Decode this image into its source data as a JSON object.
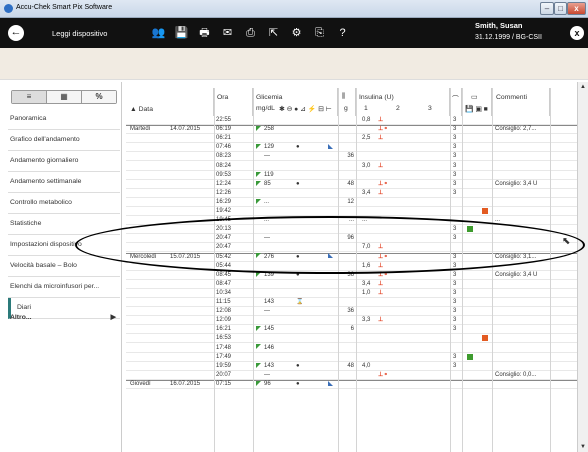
{
  "window": {
    "title": "Accu-Chek Smart Pix Software",
    "min_label": "–",
    "max_label": "□",
    "close_label": "x"
  },
  "toolbar": {
    "back_icon": "←",
    "read_device_label": "Leggi dispositivo",
    "icons": [
      {
        "name": "users-icon",
        "glyph": "👥"
      },
      {
        "name": "save-icon",
        "glyph": "💾"
      },
      {
        "name": "print-icon",
        "glyph": "🖶"
      },
      {
        "name": "email-icon",
        "glyph": "✉"
      },
      {
        "name": "pdf-icon",
        "glyph": "⎙"
      },
      {
        "name": "export-icon",
        "glyph": "⇱"
      },
      {
        "name": "settings-icon",
        "glyph": "⚙"
      },
      {
        "name": "device-icon",
        "glyph": "⎘"
      },
      {
        "name": "help-icon",
        "glyph": "?"
      }
    ]
  },
  "patient": {
    "name": "Smith, Susan",
    "info": "31.12.1999 / BG-CSII",
    "close_label": "x"
  },
  "view_toggle": [
    "≡",
    "▦",
    "%"
  ],
  "nav": {
    "items": [
      {
        "label": "Panoramica",
        "active": false
      },
      {
        "label": "Grafico dell'andamento",
        "active": false
      },
      {
        "label": "Andamento giornaliero",
        "active": false
      },
      {
        "label": "Andamento settimanale",
        "active": false
      },
      {
        "label": "Controllo metabolico",
        "active": false
      },
      {
        "label": "Statistiche",
        "active": false
      },
      {
        "label": "Impostazioni dispositivo",
        "active": false
      },
      {
        "label": "Velocità basale – Bolo",
        "active": false
      },
      {
        "label": "Elenchi da microinfusori per...",
        "active": false
      },
      {
        "label": "Diari",
        "active": true
      }
    ],
    "more_label": "Altro..."
  },
  "table": {
    "headers": {
      "data": "▲ Data",
      "ora": "Ora",
      "glicemia": "Glicemia",
      "glicemia_unit": "mg/dL",
      "glicemia_icons": "✱ ⊖ ● ⊿ ⚡ ⊟ ⊢",
      "carbo": "⫼",
      "carbo_unit": "g",
      "insulina": "Insulina (U)",
      "insulina_cols": [
        "1",
        "2",
        "3"
      ],
      "basal_icon": "⌒",
      "pump_icon": "▭",
      "pump_sub_icons": "💾 ▣ ■",
      "commenti": "Commenti"
    },
    "rows": [
      {
        "day": "",
        "date": "",
        "time": "22:55",
        "flag": "",
        "bg": "",
        "evt": "",
        "mark": "",
        "carb": "",
        "ins": "0,8",
        "insmark": "⊥",
        "basal": "3",
        "pump": "",
        "comment": ""
      },
      {
        "day": "Martedì",
        "date": "14.07.2015",
        "time": "06:19",
        "flag": "green",
        "bg": "258",
        "evt": "",
        "mark": "",
        "carb": "",
        "ins": "",
        "insmark": "⊥⚬",
        "basal": "3",
        "pump": "",
        "comment": "Consiglio: 2,7..."
      },
      {
        "day": "",
        "date": "",
        "time": "06:21",
        "flag": "",
        "bg": "",
        "evt": "",
        "mark": "",
        "carb": "",
        "ins": "2,5",
        "insmark": "⊥",
        "basal": "3",
        "pump": "",
        "comment": ""
      },
      {
        "day": "",
        "date": "",
        "time": "07:46",
        "flag": "green",
        "bg": "129",
        "evt": "●",
        "mark": "blue",
        "carb": "",
        "ins": "",
        "insmark": "",
        "basal": "3",
        "pump": "",
        "comment": ""
      },
      {
        "day": "",
        "date": "",
        "time": "08:23",
        "flag": "",
        "bg": "—",
        "evt": "",
        "mark": "",
        "carb": "36",
        "ins": "",
        "insmark": "",
        "basal": "3",
        "pump": "",
        "comment": ""
      },
      {
        "day": "",
        "date": "",
        "time": "08:24",
        "flag": "",
        "bg": "",
        "evt": "",
        "mark": "",
        "carb": "",
        "ins": "3,0",
        "insmark": "⊥",
        "basal": "3",
        "pump": "",
        "comment": ""
      },
      {
        "day": "",
        "date": "",
        "time": "09:53",
        "flag": "green",
        "bg": "119",
        "evt": "",
        "mark": "",
        "carb": "",
        "ins": "",
        "insmark": "",
        "basal": "3",
        "pump": "",
        "comment": ""
      },
      {
        "day": "",
        "date": "",
        "time": "12:24",
        "flag": "green",
        "bg": "85",
        "evt": "●",
        "mark": "",
        "carb": "48",
        "ins": "",
        "insmark": "⊥⚬",
        "basal": "3",
        "pump": "",
        "comment": "Consiglio: 3,4 U"
      },
      {
        "day": "",
        "date": "",
        "time": "12:26",
        "flag": "",
        "bg": "",
        "evt": "",
        "mark": "",
        "carb": "",
        "ins": "3,4",
        "insmark": "⊥",
        "basal": "3",
        "pump": "",
        "comment": ""
      },
      {
        "day": "",
        "date": "",
        "time": "16:29",
        "flag": "green",
        "bg": "...",
        "evt": "",
        "mark": "",
        "carb": "12",
        "ins": "",
        "insmark": "",
        "basal": "",
        "pump": "",
        "comment": ""
      },
      {
        "day": "",
        "date": "",
        "time": "19:42",
        "flag": "",
        "bg": "",
        "evt": "",
        "mark": "",
        "carb": "",
        "ins": "",
        "insmark": "",
        "basal": "",
        "pump": "orange",
        "comment": ""
      },
      {
        "day": "",
        "date": "",
        "time": "19:45",
        "flag": "",
        "bg": "...",
        "evt": "",
        "mark": "",
        "carb": "...",
        "ins": "...",
        "insmark": "",
        "basal": "",
        "pump": "",
        "comment": "..."
      },
      {
        "day": "",
        "date": "",
        "time": "20:13",
        "flag": "",
        "bg": "",
        "evt": "",
        "mark": "",
        "carb": "",
        "ins": "",
        "insmark": "",
        "basal": "3",
        "pump": "green",
        "comment": ""
      },
      {
        "day": "",
        "date": "",
        "time": "20:47",
        "flag": "",
        "bg": "—",
        "evt": "",
        "mark": "",
        "carb": "96",
        "ins": "",
        "insmark": "",
        "basal": "3",
        "pump": "",
        "comment": ""
      },
      {
        "day": "",
        "date": "",
        "time": "20:47",
        "flag": "",
        "bg": "",
        "evt": "",
        "mark": "",
        "carb": "",
        "ins": "7,0",
        "insmark": "⊥",
        "basal": "",
        "pump": "",
        "comment": ""
      },
      {
        "day": "Mercoledì",
        "date": "15.07.2015",
        "time": "05:42",
        "flag": "green",
        "bg": "276",
        "evt": "●",
        "mark": "blue",
        "carb": "",
        "ins": "",
        "insmark": "⊥⚬",
        "basal": "3",
        "pump": "",
        "comment": "Consiglio: 3,1..."
      },
      {
        "day": "",
        "date": "",
        "time": "05:44",
        "flag": "",
        "bg": "",
        "evt": "",
        "mark": "",
        "carb": "",
        "ins": "1,6",
        "insmark": "⊥",
        "basal": "3",
        "pump": "",
        "comment": ""
      },
      {
        "day": "",
        "date": "",
        "time": "08:45",
        "flag": "green",
        "bg": "139",
        "evt": "●",
        "mark": "",
        "carb": "36",
        "ins": "",
        "insmark": "⊥⚬",
        "basal": "3",
        "pump": "",
        "comment": "Consiglio: 3,4 U"
      },
      {
        "day": "",
        "date": "",
        "time": "08:47",
        "flag": "",
        "bg": "",
        "evt": "",
        "mark": "",
        "carb": "",
        "ins": "3,4",
        "insmark": "⊥",
        "basal": "3",
        "pump": "",
        "comment": ""
      },
      {
        "day": "",
        "date": "",
        "time": "10:34",
        "flag": "",
        "bg": "",
        "evt": "",
        "mark": "",
        "carb": "",
        "ins": "1,0",
        "insmark": "⊥",
        "basal": "3",
        "pump": "",
        "comment": ""
      },
      {
        "day": "",
        "date": "",
        "time": "11:15",
        "flag": "",
        "bg": "143",
        "evt": "⌛",
        "mark": "",
        "carb": "",
        "ins": "",
        "insmark": "",
        "basal": "3",
        "pump": "",
        "comment": ""
      },
      {
        "day": "",
        "date": "",
        "time": "12:08",
        "flag": "",
        "bg": "—",
        "evt": "",
        "mark": "",
        "carb": "36",
        "ins": "",
        "insmark": "",
        "basal": "3",
        "pump": "",
        "comment": ""
      },
      {
        "day": "",
        "date": "",
        "time": "12:09",
        "flag": "",
        "bg": "",
        "evt": "",
        "mark": "",
        "carb": "",
        "ins": "3,3",
        "insmark": "⊥",
        "basal": "3",
        "pump": "",
        "comment": ""
      },
      {
        "day": "",
        "date": "",
        "time": "16:21",
        "flag": "green",
        "bg": "145",
        "evt": "",
        "mark": "",
        "carb": "6",
        "ins": "",
        "insmark": "",
        "basal": "3",
        "pump": "",
        "comment": ""
      },
      {
        "day": "",
        "date": "",
        "time": "16:53",
        "flag": "",
        "bg": "",
        "evt": "",
        "mark": "",
        "carb": "",
        "ins": "",
        "insmark": "",
        "basal": "",
        "pump": "orange",
        "comment": ""
      },
      {
        "day": "",
        "date": "",
        "time": "17:48",
        "flag": "green",
        "bg": "146",
        "evt": "",
        "mark": "",
        "carb": "",
        "ins": "",
        "insmark": "",
        "basal": "",
        "pump": "",
        "comment": ""
      },
      {
        "day": "",
        "date": "",
        "time": "17:49",
        "flag": "",
        "bg": "",
        "evt": "",
        "mark": "",
        "carb": "",
        "ins": "",
        "insmark": "",
        "basal": "3",
        "pump": "green",
        "comment": ""
      },
      {
        "day": "",
        "date": "",
        "time": "19:59",
        "flag": "green",
        "bg": "143",
        "evt": "●",
        "mark": "",
        "carb": "48",
        "ins": "4,0",
        "insmark": "",
        "basal": "3",
        "pump": "",
        "comment": ""
      },
      {
        "day": "",
        "date": "",
        "time": "20:07",
        "flag": "",
        "bg": "—",
        "evt": "",
        "mark": "",
        "carb": "",
        "ins": "",
        "insmark": "⊥⚬",
        "basal": "",
        "pump": "",
        "comment": "Consiglio: 0,0..."
      },
      {
        "day": "Giovedì",
        "date": "16.07.2015",
        "time": "07:15",
        "flag": "green",
        "bg": "96",
        "evt": "●",
        "mark": "blue",
        "carb": "",
        "ins": "",
        "insmark": "",
        "basal": "",
        "pump": "",
        "comment": ""
      }
    ]
  },
  "colors": {
    "toolbar_bg": "#111111",
    "banner_bg": "#f1ebe2",
    "insulin_mark": "#e23b1b",
    "flag_green": "#3a9a3a",
    "flag_blue": "#3b6fb8",
    "pump_orange": "#e35b22",
    "pump_green": "#3e9b2e"
  },
  "scroll": {
    "up_icon": "▲",
    "down_icon": "▼"
  }
}
